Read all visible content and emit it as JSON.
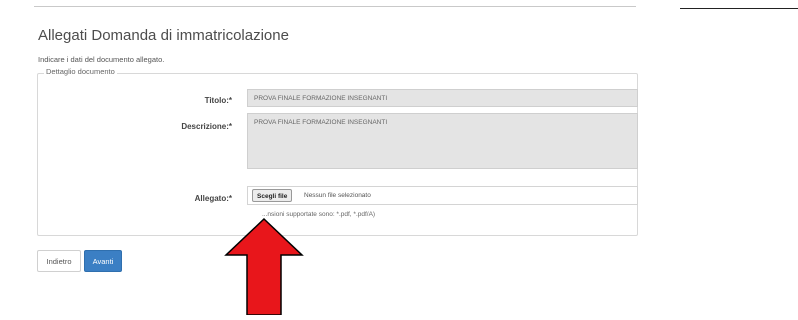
{
  "page": {
    "title": "Allegati Domanda di immatricolazione",
    "instructions": "Indicare i dati del documento allegato."
  },
  "form": {
    "legend": "Dettaglio documento",
    "titolo": {
      "label": "Titolo:*",
      "value": "PROVA FINALE FORMAZIONE INSEGNANTI"
    },
    "descrizione": {
      "label": "Descrizione:*",
      "value": "PROVA FINALE FORMAZIONE INSEGNANTI"
    },
    "allegato": {
      "label": "Allegato:*",
      "button_label": "Scegli file",
      "status": "Nessun file selezionato",
      "hint": "...nsioni supportate sono: *.pdf, *.pdf/A)"
    }
  },
  "actions": {
    "back_label": "Indietro",
    "next_label": "Avanti"
  },
  "annotation": {
    "icon": "red-arrow-up-icon",
    "color": "#e8161b"
  },
  "colors": {
    "primary_button": "#3b7fc4",
    "readonly_field": "#e4e4e4"
  }
}
